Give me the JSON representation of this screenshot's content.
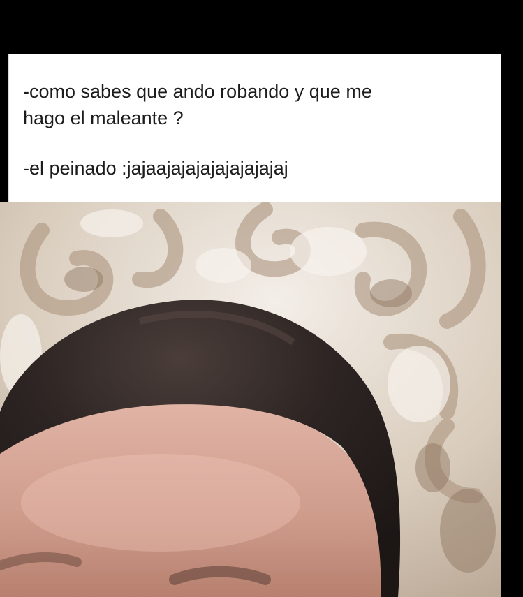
{
  "post": {
    "line1": "-como sabes que ando robando y que me",
    "line2": "hago el maleante ?",
    "line3": "-el peinado :jajaajajajajajajajajaj"
  },
  "colors": {
    "background": "#000000",
    "card": "#ffffff",
    "text": "#1c1c1c",
    "wallpaper": "#cdbfae",
    "hair": "#2a2220",
    "skin": "#d2a596"
  },
  "photo": {
    "description_icon": "person-photo"
  }
}
